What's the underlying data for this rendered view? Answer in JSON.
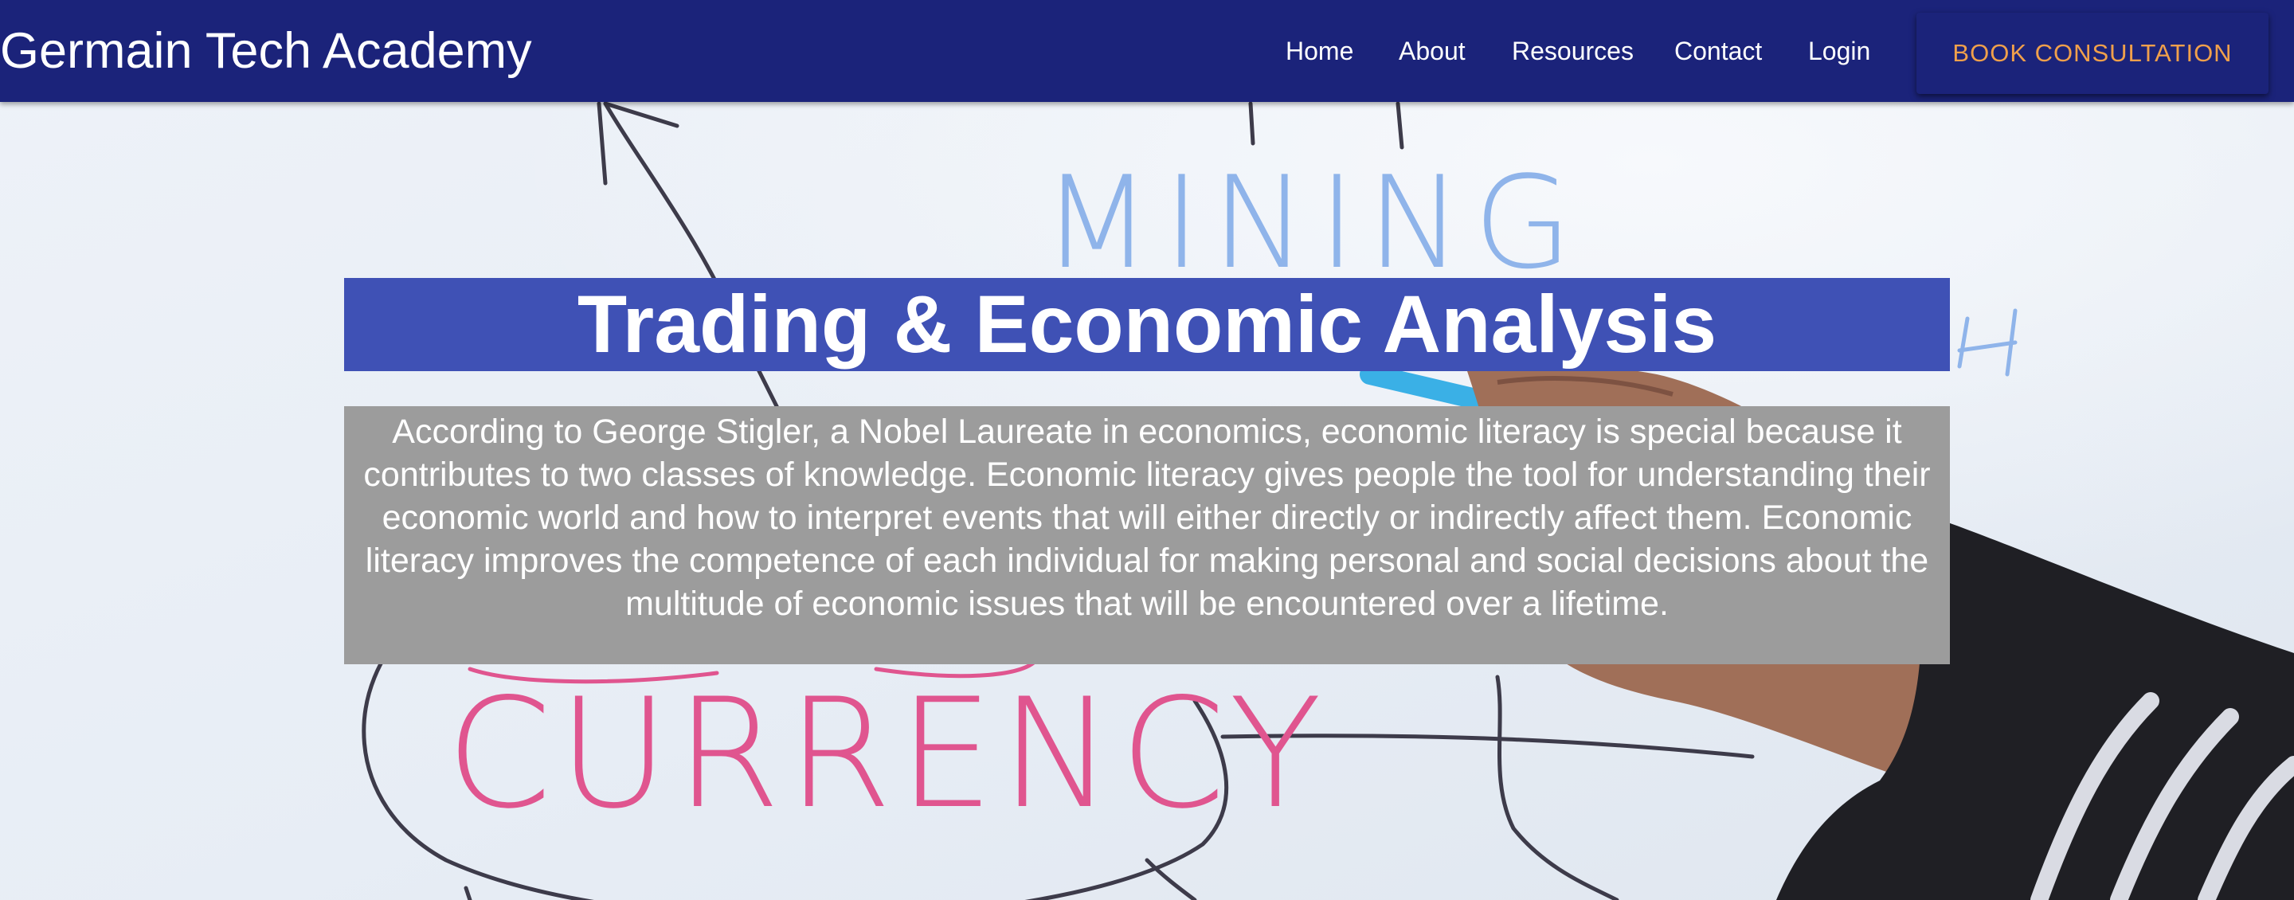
{
  "navbar": {
    "brand": "Germain Tech Academy",
    "links": [
      {
        "label": "Home"
      },
      {
        "label": "About"
      },
      {
        "label": "Resources"
      },
      {
        "label": "Contact"
      },
      {
        "label": "Login"
      }
    ],
    "cta_label": "BOOK CONSULTATION"
  },
  "hero": {
    "title": "Trading & Economic Analysis",
    "description": "According to George Stigler, a Nobel Laureate in economics, economic literacy is special because it contributes to two classes of knowledge. Economic literacy gives people the tool for understanding their economic world and how to interpret events that will either directly or indirectly affect them. Economic literacy improves the competence of each individual for making personal and social decisions about the multitude of economic issues that will be encountered over a lifetime.",
    "background_words": {
      "mining": "MINING",
      "currency": "CURRENCY"
    }
  },
  "colors": {
    "navbar_bg": "#1b237a",
    "cta_text": "#f0a04b",
    "title_bg": "#3f51b5",
    "description_bg": "#9c9c9c",
    "whiteboard": "#e9eef5",
    "marker_blue": "#8fb4ea",
    "marker_pink": "#e0558f"
  }
}
